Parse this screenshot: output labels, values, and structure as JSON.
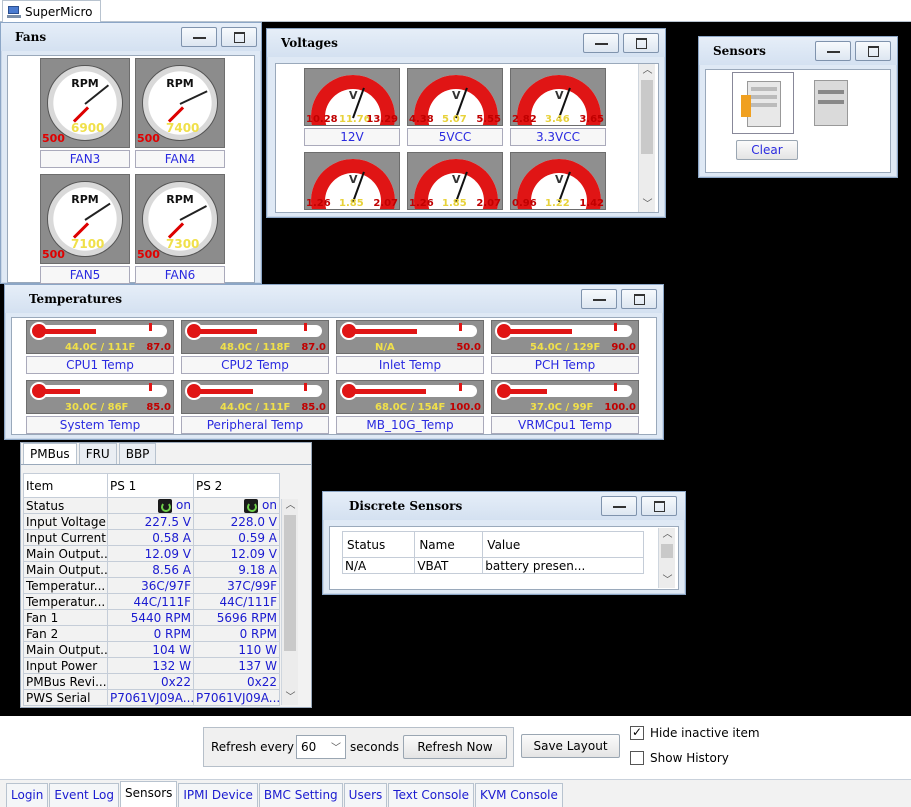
{
  "app": {
    "title": "SuperMicro",
    "icon": "computer-icon"
  },
  "fans": {
    "title": "Fans",
    "unit": "RPM",
    "items": [
      {
        "label": "FAN3",
        "value": "6900",
        "min": "500",
        "fraction": 0.69
      },
      {
        "label": "FAN4",
        "value": "7400",
        "min": "500",
        "fraction": 0.74
      },
      {
        "label": "FAN5",
        "value": "7100",
        "min": "500",
        "fraction": 0.71
      },
      {
        "label": "FAN6",
        "value": "7300",
        "min": "500",
        "fraction": 0.73
      }
    ]
  },
  "voltages": {
    "title": "Voltages",
    "unit": "V",
    "items": [
      {
        "label": "12V",
        "low": "10.28",
        "value": "11.76",
        "high": "13.29"
      },
      {
        "label": "5VCC",
        "low": "4.38",
        "value": "5.07",
        "high": "5.55"
      },
      {
        "label": "3.3VCC",
        "low": "2.82",
        "value": "3.46",
        "high": "3.65"
      },
      {
        "label": "",
        "low": "1.26",
        "value": "1.85",
        "high": "2.07"
      },
      {
        "label": "",
        "low": "1.26",
        "value": "1.85",
        "high": "2.07"
      },
      {
        "label": "",
        "low": "0.96",
        "value": "1.22",
        "high": "1.42"
      }
    ]
  },
  "sensors_panel": {
    "title": "Sensors",
    "clear_label": "Clear"
  },
  "temperatures": {
    "title": "Temperatures",
    "items": [
      {
        "label": "CPU1 Temp",
        "value": "44.0C / 111F",
        "max": "87.0",
        "level": 0.5
      },
      {
        "label": "CPU2 Temp",
        "value": "48.0C / 118F",
        "max": "87.0",
        "level": 0.55
      },
      {
        "label": "Inlet Temp",
        "value": "N/A",
        "max": "50.0",
        "level": 0.6
      },
      {
        "label": "PCH Temp",
        "value": "54.0C / 129F",
        "max": "90.0",
        "level": 0.6
      },
      {
        "label": "System Temp",
        "value": "30.0C / 86F",
        "max": "85.0",
        "level": 0.35
      },
      {
        "label": "Peripheral Temp",
        "value": "44.0C / 111F",
        "max": "85.0",
        "level": 0.52
      },
      {
        "label": "MB_10G_Temp",
        "value": "68.0C / 154F",
        "max": "100.0",
        "level": 0.68
      },
      {
        "label": "VRMCpu1 Temp",
        "value": "37.0C / 99F",
        "max": "100.0",
        "level": 0.37
      }
    ]
  },
  "pmbus": {
    "tabs": [
      "PMBus",
      "FRU",
      "BBP"
    ],
    "active_tab": "PMBus",
    "columns": [
      "Item",
      "PS 1",
      "PS 2"
    ],
    "rows": [
      {
        "item": "Status",
        "ps1": "on",
        "ps2": "on",
        "status": true
      },
      {
        "item": "Input Voltage",
        "ps1": "227.5 V",
        "ps2": "228.0 V"
      },
      {
        "item": "Input Current",
        "ps1": "0.58 A",
        "ps2": "0.59 A"
      },
      {
        "item": "Main Output...",
        "ps1": "12.09 V",
        "ps2": "12.09 V"
      },
      {
        "item": "Main Output...",
        "ps1": "8.56 A",
        "ps2": "9.18 A"
      },
      {
        "item": "Temperatur...",
        "ps1": "36C/97F",
        "ps2": "37C/99F"
      },
      {
        "item": "Temperatur...",
        "ps1": "44C/111F",
        "ps2": "44C/111F"
      },
      {
        "item": "Fan 1",
        "ps1": "5440 RPM",
        "ps2": "5696 RPM"
      },
      {
        "item": "Fan 2",
        "ps1": "0 RPM",
        "ps2": "0 RPM"
      },
      {
        "item": "Main Output...",
        "ps1": "104 W",
        "ps2": "110 W"
      },
      {
        "item": "Input Power",
        "ps1": "132 W",
        "ps2": "137 W"
      },
      {
        "item": "PMBus Revi...",
        "ps1": "0x22",
        "ps2": "0x22"
      },
      {
        "item": "PWS Serial",
        "ps1": "P7061VJ09A...",
        "ps2": "P7061VJ09A..."
      }
    ]
  },
  "discrete": {
    "title": "Discrete Sensors",
    "columns": [
      "Status",
      "Name",
      "Value"
    ],
    "rows": [
      {
        "status": "N/A",
        "name": "VBAT",
        "value": "battery presen..."
      }
    ]
  },
  "controls": {
    "refresh_label": "Refresh every",
    "refresh_value": "60",
    "seconds_label": "seconds",
    "refresh_now": "Refresh Now",
    "save_layout": "Save Layout",
    "hide_inactive": "Hide inactive item",
    "hide_inactive_checked": true,
    "show_history": "Show History",
    "show_history_checked": false
  },
  "bottom_tabs": [
    "Login",
    "Event Log",
    "Sensors",
    "IPMI Device",
    "BMC Setting",
    "Users",
    "Text Console",
    "KVM Console"
  ],
  "active_bottom_tab": "Sensors",
  "colors": {
    "desktop": "#000000",
    "gauge_red": "#e01515",
    "link_blue": "#2a2ae0",
    "value_yellow": "#f0e04a"
  }
}
